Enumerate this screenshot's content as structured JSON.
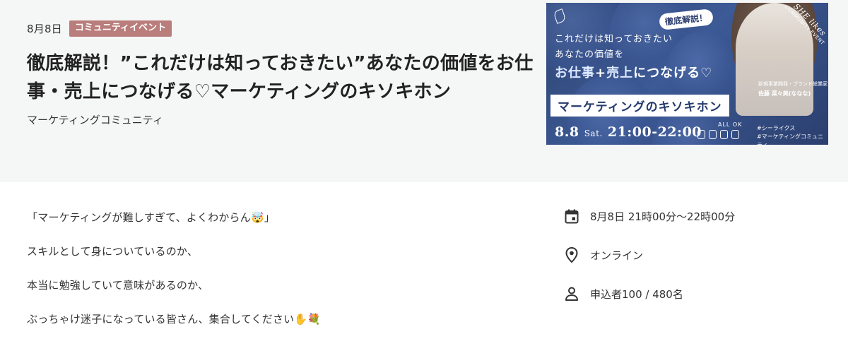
{
  "header": {
    "date": "8月8日",
    "category": "コミュニティイベント",
    "title": "徹底解説！”これだけは知っておきたい”あなたの価値をお仕事・売上につなげる♡マーケティングのキソキホン",
    "community": "マーケティングコミュニティ"
  },
  "banner": {
    "tagline": "徹底解説！",
    "line1": "これだけは知っておきたい",
    "line2": "あなたの価値を",
    "line3_a": "お仕事",
    "line3_plus": "+",
    "line3_b": "売上",
    "line3_c": "につなげる♡",
    "kiso": "マーケティングのキソキホン",
    "date": "8.8",
    "day": "Sat.",
    "time": "21:00-22:00",
    "allok": "ALL OK",
    "hashtag1": "#シーライクス",
    "hashtag2": "#マーケティングコミュニティ",
    "person_role": "新規事業開発・ブランド総業家",
    "person_name": "佐藤 菜々美(ななな)",
    "ribbon_brand": "SHE likes",
    "ribbon_text": "COMMUNITY EVENT"
  },
  "description": {
    "p1": "「マーケティングが難しすぎて、よくわからん🤯」",
    "p2": "スキルとして身についているのか、",
    "p3": "本当に勉強していて意味があるのか、",
    "p4": "ぶっちゃけ迷子になっている皆さん、集合してください✋💐"
  },
  "info": {
    "datetime": "8月8日 21時00分〜22時00分",
    "location": "オンライン",
    "applicants": "申込者100 / 480名",
    "icons": [
      "calendar-icon",
      "location-pin-icon",
      "person-icon"
    ]
  },
  "colors": {
    "header_bg": "#f5f6f6",
    "badge_bg": "#b97d7b",
    "banner_blue": "#3c5a96",
    "text": "#333333"
  }
}
